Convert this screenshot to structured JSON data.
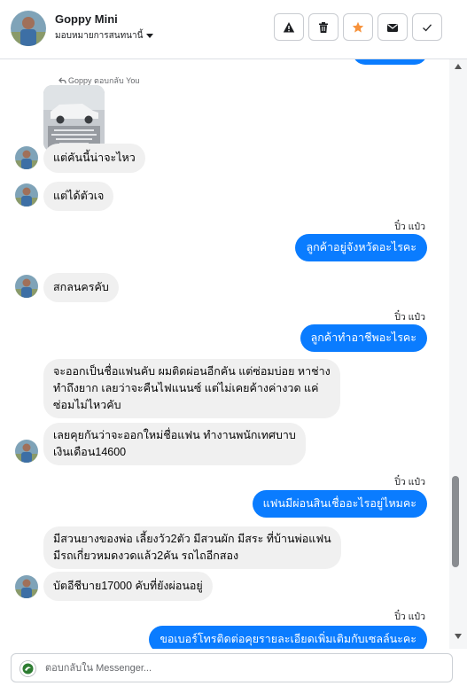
{
  "header": {
    "contact_name": "Goppy Mini",
    "assign_label": "มอบหมายการสนทนานี้",
    "actions": [
      {
        "name": "report-spam-button",
        "icon": "warning-icon"
      },
      {
        "name": "delete-button",
        "icon": "trash-icon"
      },
      {
        "name": "star-button",
        "icon": "star-icon",
        "color": "#f7923b"
      },
      {
        "name": "mark-unread-button",
        "icon": "envelope-icon"
      },
      {
        "name": "mark-done-button",
        "icon": "check-icon"
      }
    ]
  },
  "conversation": {
    "reply_note": "Goppy ตอบกลับ You",
    "messages": [
      {
        "from": "contact",
        "text": "แต่คันนี้น่าจะไหว"
      },
      {
        "from": "contact",
        "text": "แต่ได้ตัวเจ"
      },
      {
        "from": "page",
        "sender": "ปิ๋ว แป๋ว",
        "text": "ลูกค้าอยู่จังหวัดอะไรคะ"
      },
      {
        "from": "contact",
        "text": "สกลนครคับ"
      },
      {
        "from": "page",
        "sender": "ปิ๋ว แป๋ว",
        "text": "ลูกค้าทำอาชีพอะไรคะ"
      },
      {
        "from": "contact",
        "lines": [
          "จะออกเป็นชื่อแฟนคับ ผมติดผ่อนอีกคัน แต่ซ่อมบ่อย หาช่าง",
          "ทำถึงยาก เลยว่าจะคืนไฟแนนซ์ แต่ไม่เคยค้างค่างวด แค่",
          "ซ่อมไม่ไหวคับ"
        ]
      },
      {
        "from": "contact",
        "lines": [
          "เลยคุยกันว่าจะออกใหม่ชื่อแฟน  ทำงานพนักเทศบาบ",
          "เงินเดือน14600"
        ]
      },
      {
        "from": "page",
        "sender": "ปิ๋ว แป๋ว",
        "text": "แฟนมีผ่อนสินเชื่ออะไรอยู่ไหมคะ"
      },
      {
        "from": "contact",
        "lines": [
          "มีสวนยางของพ่อ เลี้ยงวัว2ตัว มีสวนผัก มีสระ ที่บ้านพ่อแฟน",
          "มีรถเกี่ยวหมดงวดแล้ว2คัน รถไถอีกสอง"
        ]
      },
      {
        "from": "contact",
        "text": "บัตอีชีบาย17000 คับที่ยังผ่อนอยู่"
      },
      {
        "from": "page",
        "sender": "ปิ๋ว แป๋ว",
        "text": "ขอเบอร์โทรติดต่อคุยรายละเอียดเพิ่มเติมกับเซลล์นะคะ"
      }
    ]
  },
  "composer": {
    "placeholder": "ตอบกลับใน Messenger..."
  },
  "colors": {
    "outgoing_bubble": "#0a7cff",
    "incoming_bubble": "#f0f0f0"
  }
}
